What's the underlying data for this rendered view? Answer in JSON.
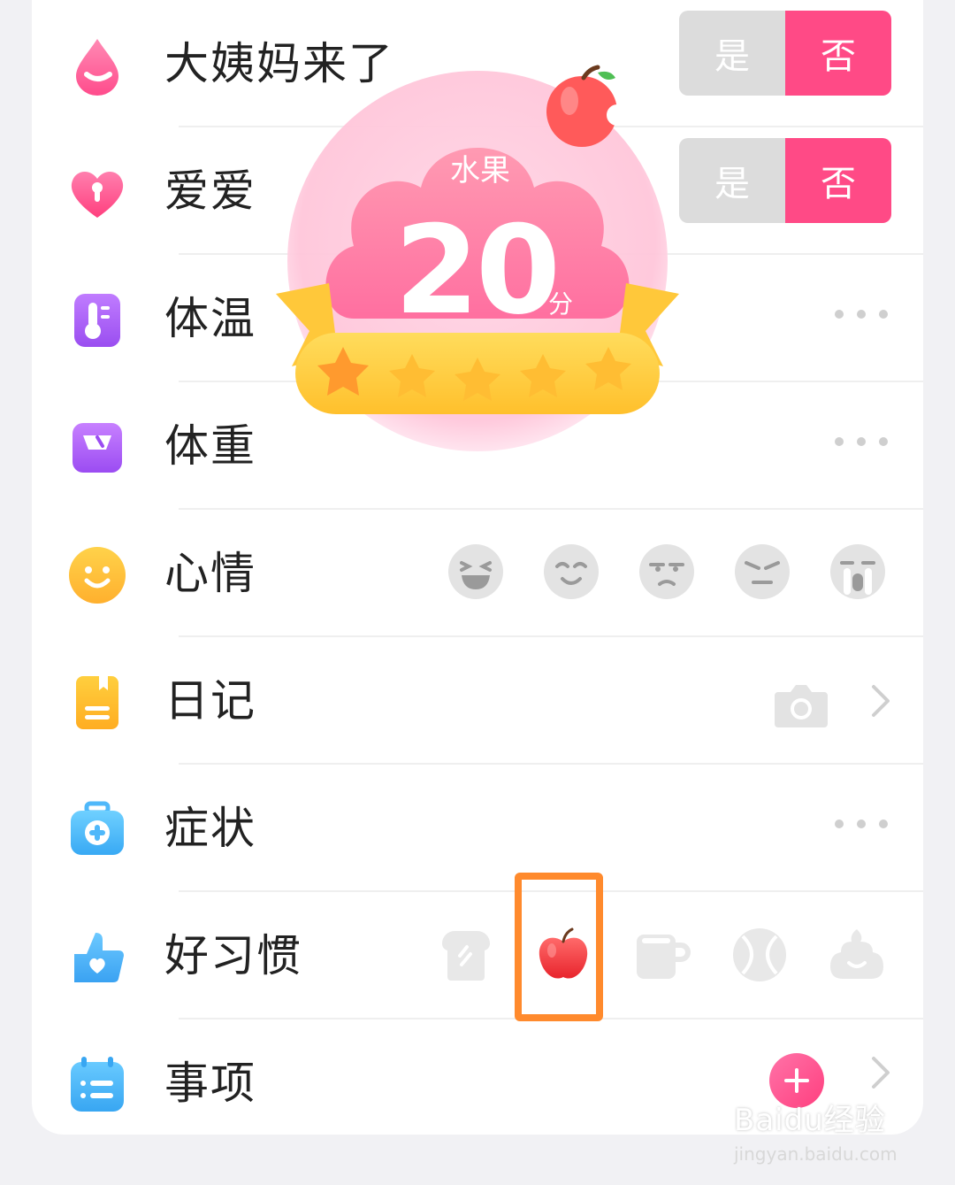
{
  "rows": [
    {
      "label": "大姨妈来了",
      "icon": "drop-icon",
      "toggle": {
        "yes": "是",
        "no": "否",
        "selected": "no"
      }
    },
    {
      "label": "爱爱",
      "icon": "heart-icon",
      "toggle": {
        "yes": "是",
        "no": "否",
        "selected": "no"
      }
    },
    {
      "label": "体温",
      "icon": "thermometer-icon"
    },
    {
      "label": "体重",
      "icon": "scale-icon"
    },
    {
      "label": "心情",
      "icon": "smile-icon"
    },
    {
      "label": "日记",
      "icon": "diary-icon"
    },
    {
      "label": "症状",
      "icon": "medical-kit-icon"
    },
    {
      "label": "好习惯",
      "icon": "thumbs-up-icon"
    },
    {
      "label": "事项",
      "icon": "calendar-list-icon"
    }
  ],
  "moods": [
    "laughing-face-icon",
    "smiling-face-icon",
    "annoyed-face-icon",
    "angry-face-icon",
    "crying-face-icon"
  ],
  "habits": [
    {
      "icon": "toast-icon",
      "active": false
    },
    {
      "icon": "apple-icon",
      "active": true
    },
    {
      "icon": "cup-icon",
      "active": false
    },
    {
      "icon": "ball-icon",
      "active": false
    },
    {
      "icon": "poop-icon",
      "active": false
    }
  ],
  "badge": {
    "category": "水果",
    "score": "20",
    "unit": "分",
    "stars": 5,
    "stars_filled": 1
  },
  "watermark": {
    "text": "Baidu经验",
    "url": "jingyan.baidu.com"
  },
  "colors": {
    "accent_pink": "#ff4a86",
    "highlight_orange": "#ff8a2d"
  }
}
